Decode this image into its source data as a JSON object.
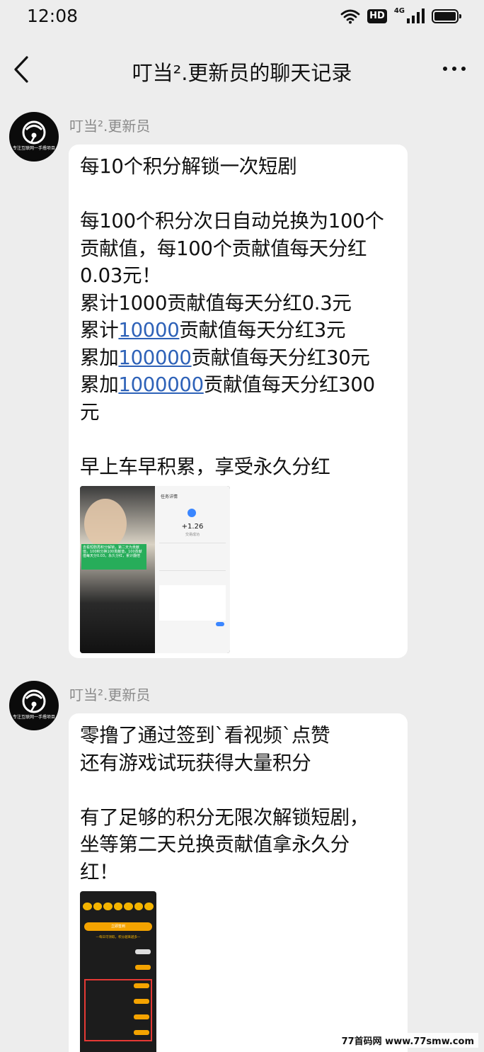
{
  "status_bar": {
    "time": "12:08",
    "hd_label": "HD",
    "network_label": "4G"
  },
  "nav": {
    "title": "叮当².更新员的聊天记录"
  },
  "messages": [
    {
      "sender": "叮当².更新员",
      "avatar_caption": "专注互联网一手撸项目",
      "lines": [
        "每10个积分解锁一次短剧",
        "每100个积分次日自动兑换为100个",
        "贡献值，每100个贡献值每天分红",
        "0.03元！",
        "累计1000贡献值每天分红0.3元",
        "累计",
        "10000",
        "贡献值每天分红3元",
        "累加",
        "100000",
        "贡献值每天分红30元",
        "累加",
        "1000000",
        "贡献值每天分红300",
        "元",
        "早上车早积累，享受永久分红"
      ],
      "screenshot": {
        "left_overlay_text": "去看短剧再积分解锁，第二天为贡献值，100积分换100贡献值，100贡献值每天分0.03，永久分红，累计翻倍",
        "title": "任务详情",
        "amount": "+1.26",
        "amount_label": "交易成功"
      }
    },
    {
      "sender": "叮当².更新员",
      "avatar_caption": "专注互联网一手撸项目",
      "lines": [
        "零撸了通过签到`看视频`点赞",
        "还有游戏试玩获得大量积分",
        "有了足够的积分无限次解锁短剧，",
        "坐等第二天兑换贡献值拿永久分",
        "红！"
      ],
      "screenshot": {
        "sign_button": "立即签到",
        "section_title": "—每日可领取，积分越来越多—"
      }
    }
  ],
  "watermark": "77首码网 www.77smw.com",
  "colors": {
    "background": "#ededed",
    "bubble": "#ffffff",
    "link": "#2e62b8",
    "name": "#8a8a8a"
  }
}
